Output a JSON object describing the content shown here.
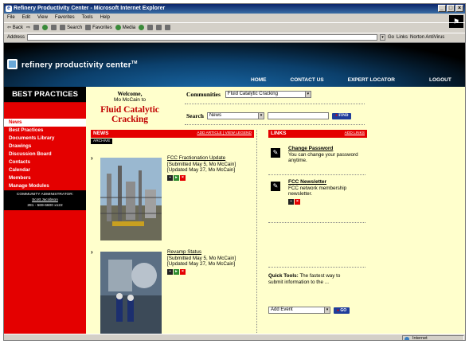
{
  "window": {
    "title": "Refinery Productivity Center - Microsoft Internet Explorer",
    "minimize": "_",
    "maximize": "□",
    "close": "×"
  },
  "menu": [
    "File",
    "Edit",
    "View",
    "Favorites",
    "Tools",
    "Help"
  ],
  "toolbar": {
    "back": "⇦ Back",
    "forward": "⇨",
    "search": "Search",
    "favorites": "Favorites",
    "media": "Media"
  },
  "addressbar": {
    "label": "Address",
    "go": "Go",
    "links": "Links",
    "antivirus": "Norton AntiVirus"
  },
  "site": {
    "logo": "refinery productivity center",
    "logo_tm": "TM",
    "nav": {
      "home": "HOME",
      "contact": "CONTACT US",
      "expert": "EXPERT LOCATOR",
      "logout": "LOGOUT"
    }
  },
  "sidebar": {
    "title": "BEST PRACTICES",
    "items": [
      {
        "label": "News"
      },
      {
        "label": "Best Practices"
      },
      {
        "label": "Documents Library"
      },
      {
        "label": "Drawings"
      },
      {
        "label": "Discussion Board"
      },
      {
        "label": "Contacts"
      },
      {
        "label": "Calendar"
      },
      {
        "label": "Members"
      },
      {
        "label": "Manage Modules"
      }
    ],
    "admin": {
      "label": "COMMUNITY ADMINISTRATOR:",
      "name": "Scott Jacobson",
      "phone": "281 - 569-6600 x122"
    }
  },
  "welcome": {
    "greeting": "Welcome,",
    "user": "Mo McCain to",
    "community": "Fluid Catalytic Cracking"
  },
  "communities": {
    "label": "Communities",
    "selected": "Fluid Catalytic Cracking"
  },
  "search": {
    "label": "Search",
    "scope": "News",
    "query": "",
    "button": "FIND"
  },
  "news": {
    "title": "NEWS",
    "actions": "ADD ARTICLE | VIEW LEGEND",
    "archive": "ARCHIVE",
    "items": [
      {
        "title": "FCC Fractionation Update",
        "submitted": "[Submitted May 5, Mo McCain]",
        "updated": "[Updated May 27, Mo McCain]"
      },
      {
        "title": "Revamp Status",
        "submitted": "[Submitted May 5, Mo McCain]",
        "updated": "[Updated May 27, Mo McCain]"
      }
    ]
  },
  "links": {
    "title": "LINKS",
    "add": "ADD LINKS",
    "items": [
      {
        "title": "Change Password",
        "desc": "You can change your password anytime."
      },
      {
        "title": "FCC Newsletter",
        "desc": "FCC network membership newsletter."
      }
    ]
  },
  "quick_tools": {
    "label": "Quick Tools:",
    "text": "The fastest way to submit information to the ...",
    "select": "Add Event",
    "button": "GO"
  },
  "statusbar": {
    "zone": "Internet"
  },
  "colors": {
    "brand_red": "#e40000",
    "content_bg": "#ffffcc",
    "title_red": "#c00000"
  }
}
